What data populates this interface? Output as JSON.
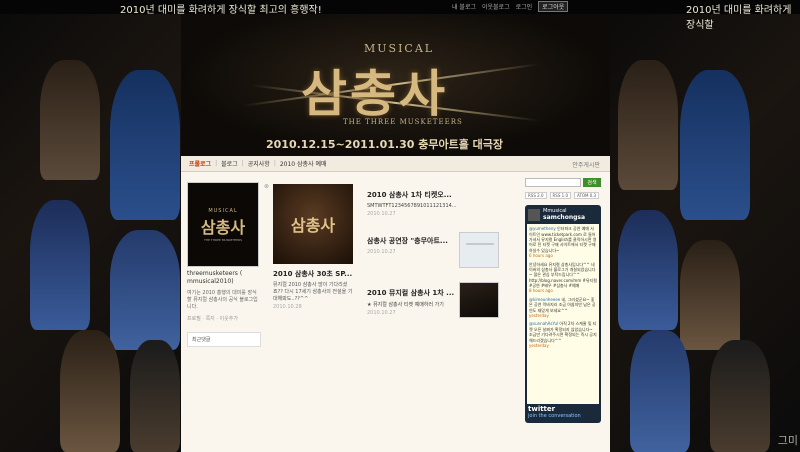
{
  "top": {
    "banner": "2010년 대미를 화려하게 장식할 최고의 흥행작!",
    "banner_right": "2010년 대미를 화려하게 장식할",
    "nav": [
      "내 블로그",
      "이웃블로그",
      "로그인"
    ],
    "login": "로그아웃"
  },
  "side": {
    "tail_text": "그미"
  },
  "header": {
    "musical": "MUSICAL",
    "title": "삼총사",
    "en_title": "THE THREE MUSKETEERS",
    "date_line": "2010.12.15~2011.01.30  충무아트홀 대극장"
  },
  "navbar": {
    "items": [
      "프롤로그",
      "블로그",
      "공지사항",
      "2010 삼총사 예매"
    ],
    "right": "안주게시판"
  },
  "profile": {
    "img_musical": "MUSICAL",
    "img_title": "삼총사",
    "img_en": "THE THREE MUSKETEERS",
    "name": "threemusketeers ( mmusical2010)",
    "desc": "여기는 2010 흥행의 대미를 장식할 뮤지컬 삼총사의 공식 블로그입니다.",
    "links": "프로필 · 쪽지 · 이웃추가",
    "recent_label": "최근댓글"
  },
  "post_a": {
    "thumb_text": "삼총사",
    "title": "2010 삼총사 30초 SP...",
    "text": "뮤지컬 2010 삼총사 많이 기다리셨죠?? 다시 17세기 삼총사의 전설을 기대해봐도..??^^",
    "date": "2010.10.28"
  },
  "post_list": [
    {
      "title": "2010 삼총사 1차 티켓오...",
      "sub": "SMTWTFT1234567891011121314...",
      "date": "2010.10.27"
    },
    {
      "title": "삼총사 공연장 \"충무아트...",
      "sub": "",
      "date": "2010.10.27"
    },
    {
      "title": "2010 뮤지컬 삼총사 1차 ...",
      "sub": "★ 뮤지컬 삼총사 티켓 예매하러 가기",
      "date": "2010.10.27"
    }
  ],
  "sidebar": {
    "search_placeholder": "",
    "search_button": "검색",
    "rss": [
      "RSS 2.0",
      "RSS 1.0",
      "ATOM 0.3"
    ]
  },
  "twitter": {
    "label": "Mmusical",
    "handle": "samchongsa",
    "tweets": [
      {
        "user": "@yumetheny",
        "text": "인터파크 공연 예매 사이트인 www.ticketpark.com 로 들어가셔서 뮤지컬 English를 클릭하시면 영어로 된 티켓 구매 사이트에서 티켓 구매하실수 있습니다~",
        "time": "6 hours ago"
      },
      {
        "user": "",
        "text": "안녕하세요 뮤지컬 삼총사입니다^^ 네이버의 삼총사 블로그가 개설되었습니다~ 많은 관심 부탁드립니다^^ http://blog.naver.com/mm #뮤지컬 #공연 #배우 #삼총사 #예매",
        "time": "8 hours ago"
      },
      {
        "user": "@kimeunheeee",
        "text": "네, 그러셨군요~ 좋은 공연 막바지라 조금 아쉽지만 남은 공연도 재밌게 보세요^^",
        "time": "yesterday"
      },
      {
        "user": "@sunnahAsYul",
        "text": "아직 2차 스케줄 및 티켓 오픈 날짜가 확정되지 않았습니다~ 조금만 기다려주시면 확정되는 즉시 공지해드리겠습니다^^",
        "time": "yesterday"
      }
    ],
    "foot_brand": "twitter",
    "foot_link": "join the conversation"
  }
}
